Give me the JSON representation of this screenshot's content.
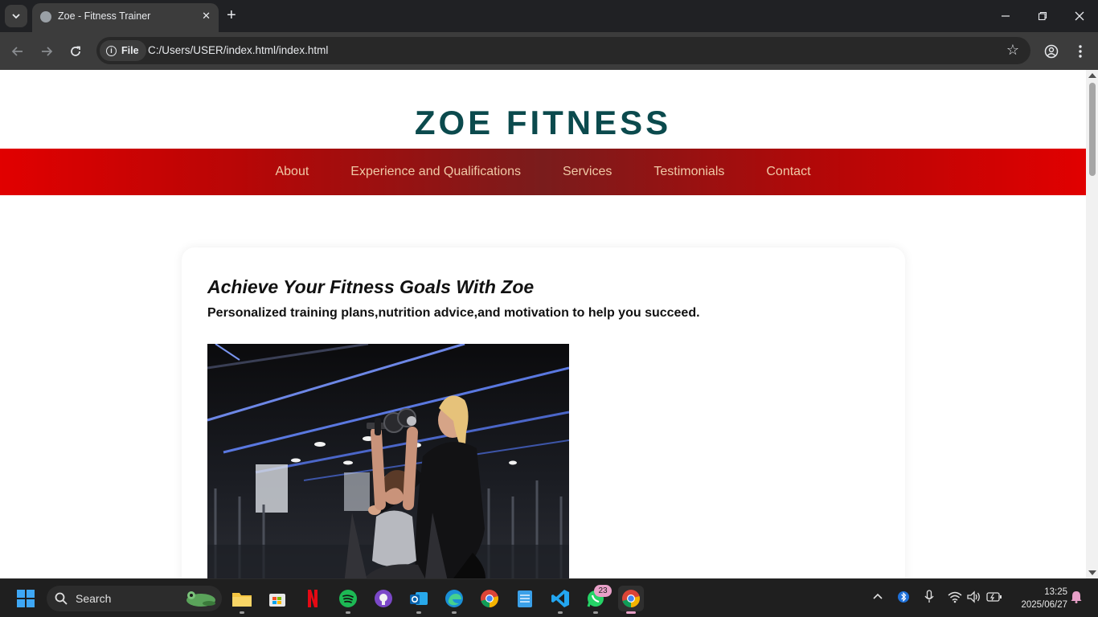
{
  "browser": {
    "tab_title": "Zoe - Fitness Trainer",
    "address_scheme_label": "File",
    "url": "C:/Users/USER/index.html/index.html"
  },
  "page": {
    "brand": "ZOE FITNESS",
    "nav": [
      "About",
      "Experience and Qualifications",
      "Services",
      "Testimonials",
      "Contact"
    ],
    "hero": {
      "title": "Achieve Your Fitness Goals With Zoe",
      "subtitle": "Personalized training plans,nutrition advice,and motivation to help you succeed."
    },
    "colors": {
      "brand_text": "#0b4a4d",
      "nav_edge": "#e10000",
      "nav_center": "#7a1c1c",
      "nav_link": "#f0c9a6"
    }
  },
  "taskbar": {
    "search_placeholder": "Search",
    "whatsapp_badge": "23",
    "time": "13:25",
    "date": "2025/06/27"
  }
}
